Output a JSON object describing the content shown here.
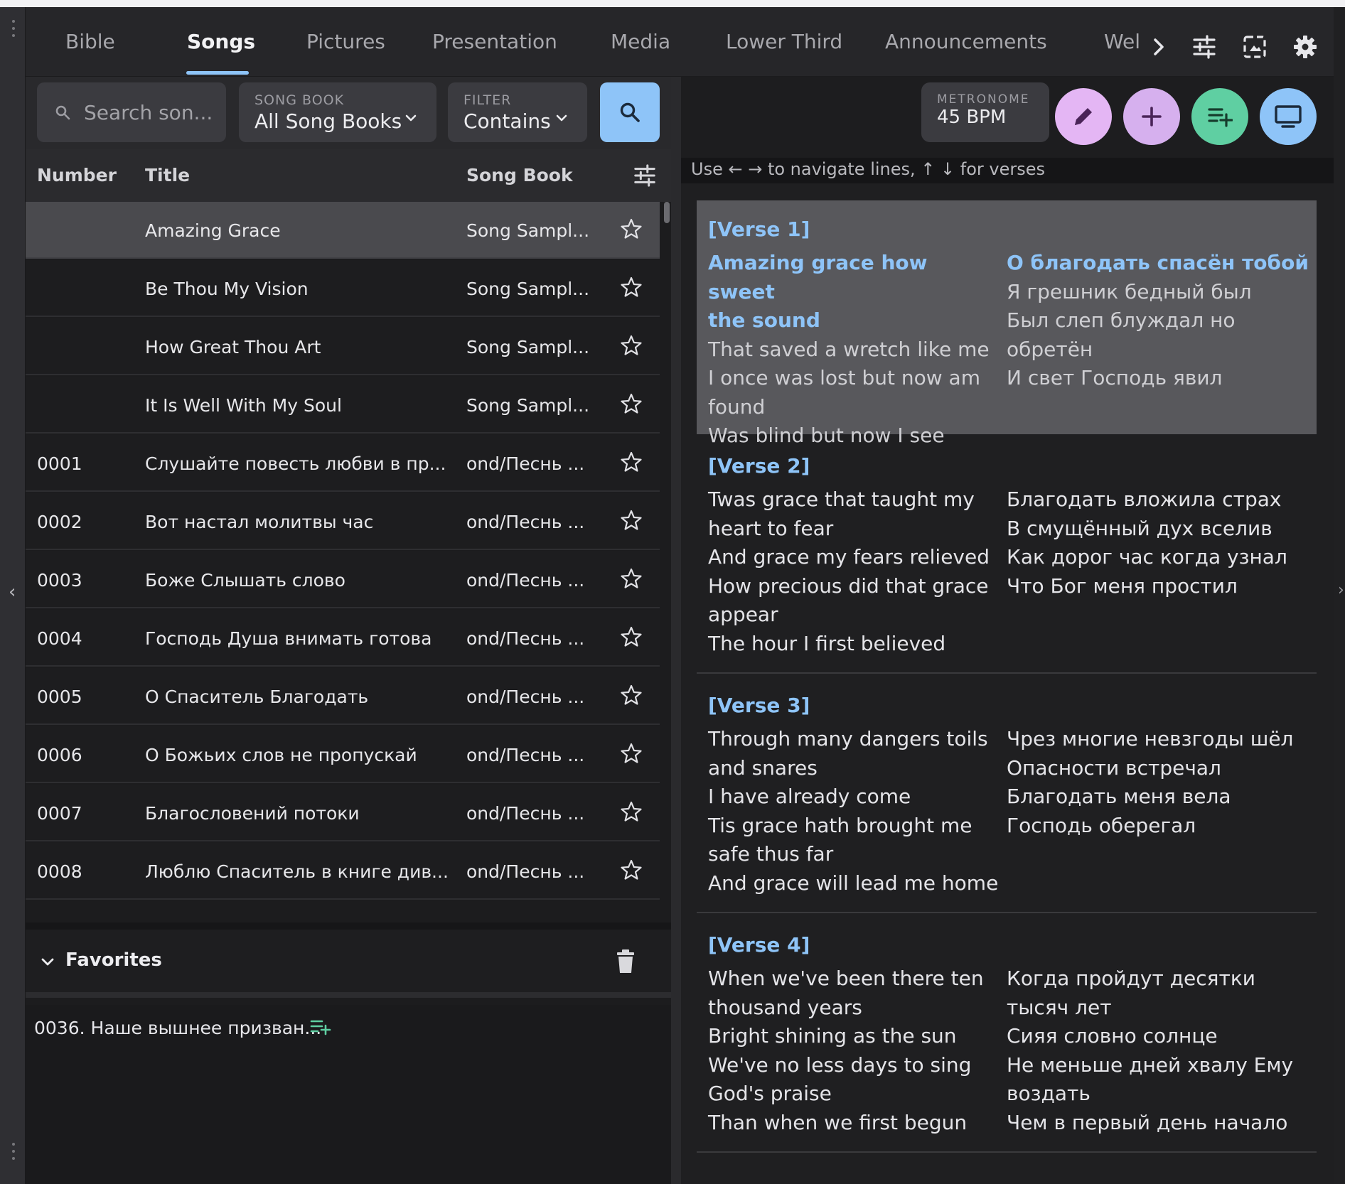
{
  "tabs": [
    {
      "label": "Bible",
      "active": false
    },
    {
      "label": "Songs",
      "active": true
    },
    {
      "label": "Pictures",
      "active": false
    },
    {
      "label": "Presentation",
      "active": false
    },
    {
      "label": "Media",
      "active": false
    },
    {
      "label": "Lower Third",
      "active": false
    },
    {
      "label": "Announcements",
      "active": false
    },
    {
      "label": "Wel",
      "active": false
    }
  ],
  "header_icons": [
    "chevron-right-icon",
    "tune-icon",
    "fit-screen-icon",
    "gear-icon"
  ],
  "search": {
    "placeholder": "Search son...",
    "song_book_label": "SONG BOOK",
    "song_book_value": "All Song Books",
    "filter_label": "FILTER",
    "filter_value": "Contains"
  },
  "table": {
    "columns": [
      "Number",
      "Title",
      "Song Book"
    ],
    "rows": [
      {
        "number": "",
        "title": "Amazing Grace",
        "book": "Song Sampl...",
        "selected": true
      },
      {
        "number": "",
        "title": "Be Thou My Vision",
        "book": "Song Sampl...",
        "selected": false
      },
      {
        "number": "",
        "title": "How Great Thou Art",
        "book": "Song Sampl...",
        "selected": false
      },
      {
        "number": "",
        "title": "It Is Well With My Soul",
        "book": "Song Sampl...",
        "selected": false
      },
      {
        "number": "0001",
        "title": "Слушайте повесть любви в пр...",
        "book": "ond/Песнь ...",
        "selected": false
      },
      {
        "number": "0002",
        "title": "Вот настал молитвы час",
        "book": "ond/Песнь ...",
        "selected": false
      },
      {
        "number": "0003",
        "title": "Боже Слышать слово",
        "book": "ond/Песнь ...",
        "selected": false
      },
      {
        "number": "0004",
        "title": "Господь Душа внимать готова",
        "book": "ond/Песнь ...",
        "selected": false
      },
      {
        "number": "0005",
        "title": "О Спаситель Благодать",
        "book": "ond/Песнь ...",
        "selected": false
      },
      {
        "number": "0006",
        "title": "О Божьих слов не пропускай",
        "book": "ond/Песнь ...",
        "selected": false
      },
      {
        "number": "0007",
        "title": "Благословений потоки",
        "book": "ond/Песнь ...",
        "selected": false
      },
      {
        "number": "0008",
        "title": "Люблю Спаситель в книге див...",
        "book": "ond/Песнь ...",
        "selected": false
      }
    ]
  },
  "favorites": {
    "title": "Favorites",
    "items": [
      "0036. Наше вышнее призван..."
    ]
  },
  "metronome": {
    "label": "METRONOME",
    "value": "45 BPM"
  },
  "fab_colors": {
    "edit": "#e4b6f4",
    "add": "#d6b0ee",
    "queue": "#5fcfa2",
    "present": "#8ec4f8"
  },
  "hint": "Use ← → to navigate lines, ↑ ↓ for verses",
  "verses": [
    {
      "heading": "[Verse 1]",
      "selected": true,
      "english": [
        "Amazing grace how sweet",
        "the sound",
        "That saved a wretch like me",
        "I once was lost but now am",
        "found",
        "Was blind but now I see"
      ],
      "russian": [
        "О благодать спасён тобой",
        "Я грешник бедный был",
        "Был слеп блуждал но",
        "обретён",
        "И свет Господь явил"
      ]
    },
    {
      "heading": "[Verse 2]",
      "selected": false,
      "english": [
        "Twas grace that taught my",
        "heart to fear",
        "And grace my fears relieved",
        "How precious did that grace",
        "appear",
        "The hour I first believed"
      ],
      "russian": [
        "Благодать вложила страх",
        "В смущённый дух вселив",
        "Как дорог час когда узнал",
        "Что Бог меня простил"
      ]
    },
    {
      "heading": "[Verse 3]",
      "selected": false,
      "english": [
        "Through many dangers toils",
        "and snares",
        "I have already come",
        "Tis grace hath brought me",
        "safe thus far",
        "And grace will lead me home"
      ],
      "russian": [
        "Чрез многие невзгоды шёл",
        "Опасности встречал",
        "Благодать меня вела",
        "Господь оберегал"
      ]
    },
    {
      "heading": "[Verse 4]",
      "selected": false,
      "english": [
        "When we've been there ten",
        "thousand years",
        "Bright shining as the sun",
        "We've no less days to sing",
        "God's praise",
        "Than when we first begun"
      ],
      "russian": [
        "Когда пройдут десятки",
        "тысяч лет",
        "Сияя словно солнце",
        "Не меньше дней хвалу Ему",
        "воздать",
        "Чем в первый день начало"
      ]
    }
  ]
}
